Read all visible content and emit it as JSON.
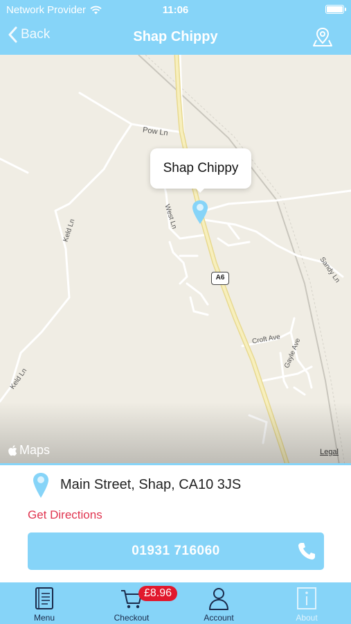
{
  "status_bar": {
    "carrier": "Network Provider",
    "time": "11:06"
  },
  "nav": {
    "back_label": "Back",
    "title": "Shap Chippy"
  },
  "map": {
    "callout": "Shap Chippy",
    "labels": {
      "pow_ln": "Pow Ln",
      "west_ln": "West Ln",
      "keld_ln_1": "Keld Ln",
      "keld_ln_2": "Keld Ln",
      "sandy_ln": "Sandy Ln",
      "croft_ave": "Croft Ave",
      "gayle_ave": "Gayle Ave",
      "road_a6": "A6"
    },
    "attribution": "Maps",
    "legal": "Legal"
  },
  "info": {
    "address": "Main Street, Shap, CA10 3JS",
    "directions": "Get Directions",
    "phone": "01931 716060"
  },
  "tabbar": {
    "menu": "Menu",
    "checkout": "Checkout",
    "checkout_badge": "£8.96",
    "account": "Account",
    "about": "About"
  },
  "colors": {
    "brand": "#86d4f8",
    "accent_red": "#e0344f",
    "badge_red": "#e1192d"
  }
}
